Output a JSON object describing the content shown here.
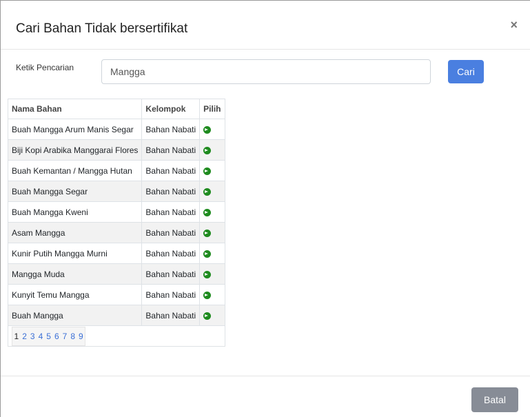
{
  "modal": {
    "title": "Cari Bahan Tidak bersertifikat",
    "close_symbol": "×"
  },
  "search": {
    "label": "Ketik Pencarian",
    "value": "Mangga",
    "button_label": "Cari"
  },
  "table": {
    "headers": [
      "Nama Bahan",
      "Kelompok",
      "Pilih"
    ],
    "rows": [
      {
        "name": "Buah Mangga Arum Manis Segar",
        "group": "Bahan Nabati",
        "icon": "arrow-circle-right-icon"
      },
      {
        "name": "Biji Kopi Arabika Manggarai Flores",
        "group": "Bahan Nabati",
        "icon": "arrow-circle-right-icon"
      },
      {
        "name": "Buah Kemantan / Mangga Hutan",
        "group": "Bahan Nabati",
        "icon": "arrow-circle-right-icon"
      },
      {
        "name": "Buah Mangga Segar",
        "group": "Bahan Nabati",
        "icon": "arrow-circle-right-icon"
      },
      {
        "name": "Buah Mangga Kweni",
        "group": "Bahan Nabati",
        "icon": "arrow-circle-right-icon"
      },
      {
        "name": "Asam Mangga",
        "group": "Bahan Nabati",
        "icon": "arrow-circle-right-icon"
      },
      {
        "name": "Kunir Putih Mangga Murni",
        "group": "Bahan Nabati",
        "icon": "arrow-circle-right-icon"
      },
      {
        "name": "Mangga Muda",
        "group": "Bahan Nabati",
        "icon": "arrow-circle-right-icon"
      },
      {
        "name": "Kunyit Temu Mangga",
        "group": "Bahan Nabati",
        "icon": "arrow-circle-right-icon"
      },
      {
        "name": "Buah Mangga",
        "group": "Bahan Nabati",
        "icon": "arrow-circle-right-icon"
      }
    ],
    "pagination": {
      "pages": [
        "1",
        "2",
        "3",
        "4",
        "5",
        "6",
        "7",
        "8",
        "9"
      ],
      "current": "1"
    }
  },
  "footer": {
    "cancel_label": "Batal"
  },
  "colors": {
    "primary": "#4a7fe0",
    "secondary": "#878c96",
    "success_icon": "#1f8b1f",
    "link": "#3a6fd6"
  }
}
